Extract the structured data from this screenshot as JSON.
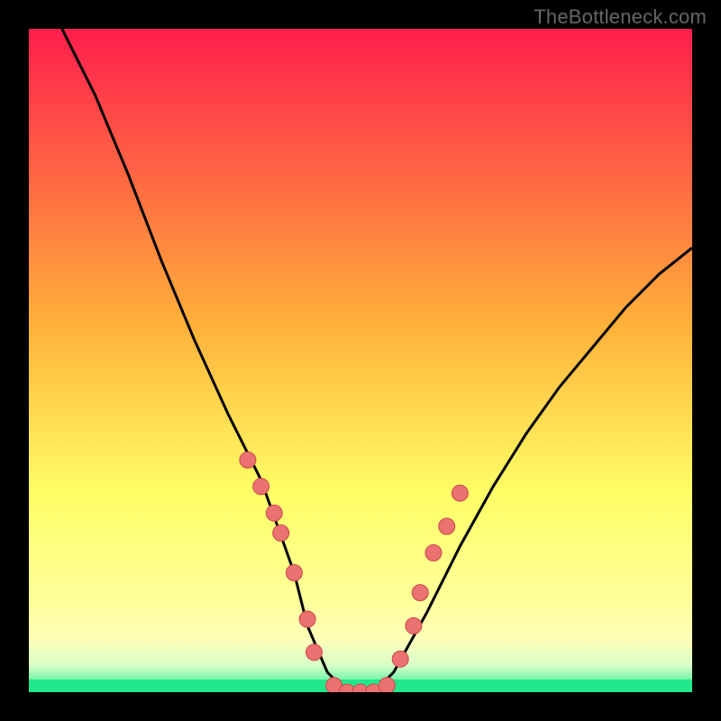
{
  "watermark": "TheBottleneck.com",
  "colors": {
    "frame": "#000000",
    "curve": "#000000",
    "marker_fill": "#ec7171",
    "marker_stroke": "#c94a4a",
    "green": "#20e88c",
    "gradient_top": "#ff1e4c",
    "gradient_mid_orange": "#ffb23a",
    "gradient_yellow": "#ffff66",
    "gradient_pale": "#ffffb8"
  },
  "chart_data": {
    "type": "line",
    "title": "",
    "xlabel": "",
    "ylabel": "",
    "xlim": [
      0,
      100
    ],
    "ylim": [
      0,
      100
    ],
    "series": [
      {
        "name": "bottleneck-curve",
        "x": [
          5,
          10,
          15,
          20,
          25,
          30,
          35,
          40,
          42,
          45,
          48,
          50,
          52,
          55,
          60,
          65,
          70,
          75,
          80,
          85,
          90,
          95,
          100
        ],
        "values": [
          100,
          90,
          78,
          65,
          53,
          42,
          32,
          18,
          10,
          3,
          0,
          0,
          0,
          3,
          12,
          22,
          31,
          39,
          46,
          52,
          58,
          63,
          67
        ]
      }
    ],
    "markers": {
      "name": "highlight-points",
      "x": [
        33,
        35,
        37,
        38,
        40,
        42,
        43,
        46,
        48,
        50,
        52,
        54,
        56,
        58,
        59,
        61,
        63,
        65
      ],
      "values": [
        35,
        31,
        27,
        24,
        18,
        11,
        6,
        1,
        0,
        0,
        0,
        1,
        5,
        10,
        15,
        21,
        25,
        30
      ]
    }
  }
}
